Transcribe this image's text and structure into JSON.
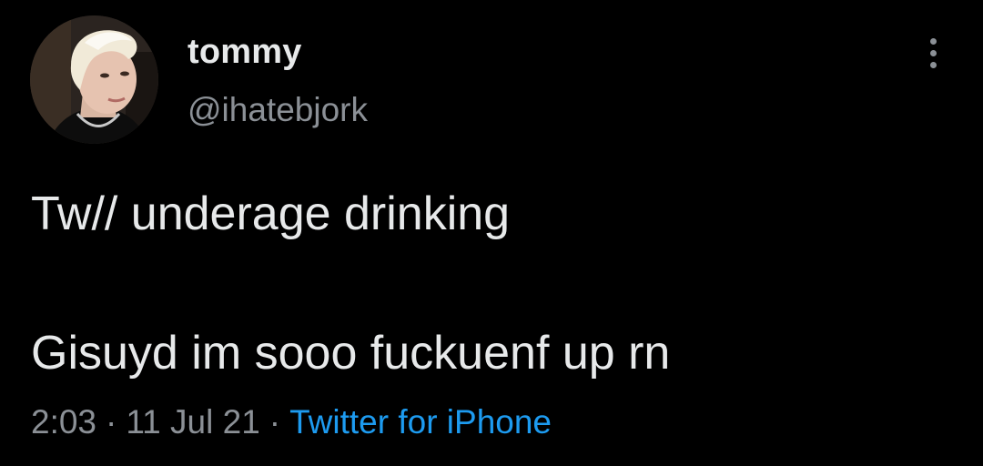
{
  "tweet": {
    "author": {
      "display_name": "tommy",
      "handle": "@ihatebjork",
      "avatar": "profile-photo"
    },
    "more_icon": "more-vertical-icon",
    "text_lines": [
      "Tw// underage drinking",
      "Gisuyd im sooo fuckuenf up rn"
    ],
    "time": "2:03",
    "date": "11 Jul 21",
    "separator": "·",
    "source": "Twitter for iPhone"
  },
  "colors": {
    "background": "#000000",
    "primary_text": "#e7e9ea",
    "secondary_text": "#8b9096",
    "accent": "#1d9bf0"
  }
}
